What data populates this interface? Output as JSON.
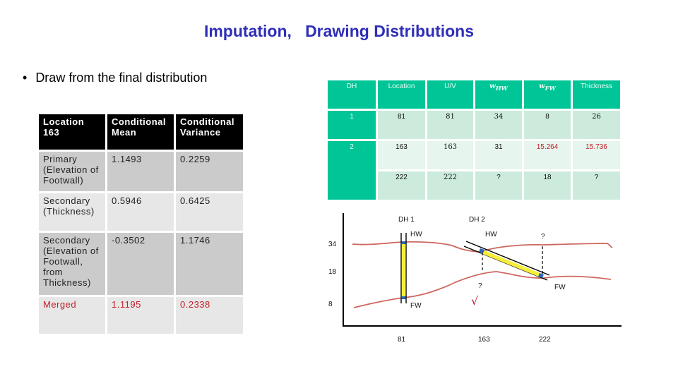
{
  "slide": {
    "title": "Imputation,   Drawing Distributions",
    "bullet": "Draw from the final distribution",
    "bullet_marker": "•"
  },
  "left_table": {
    "headers": [
      "Location 163",
      "Conditional Mean",
      "Conditional Variance"
    ],
    "rows": [
      {
        "label": "Primary (Elevation of Footwall)",
        "mean": "1.1493",
        "variance": "0.2259"
      },
      {
        "label": "Secondary (Thickness)",
        "mean": "0.5946",
        "variance": "0.6425"
      },
      {
        "label": "Secondary (Elevation of Footwall, from Thickness)",
        "mean": "-0.3502",
        "variance": "1.1746"
      },
      {
        "label": "Merged",
        "mean": "1.1195",
        "variance": "0.2338"
      }
    ],
    "highlight_color": "#c0202a"
  },
  "right_table": {
    "headers": [
      "DH",
      "Location",
      "U/V",
      "w",
      "w",
      "Thickness"
    ],
    "header_subscripts": [
      "",
      "",
      "",
      "HW",
      "FW",
      ""
    ],
    "rows": [
      {
        "dh": "1",
        "location": "81",
        "uv": "81",
        "w_hw": "34",
        "w_fw": "8",
        "thickness": "26"
      },
      {
        "dh": "2",
        "location": "163",
        "uv": "163",
        "w_hw": "31",
        "w_fw": "15.264",
        "thickness": "15.736"
      },
      {
        "dh": "",
        "location": "222",
        "uv": "222",
        "w_hw": "?",
        "w_fw": "18",
        "thickness": "?"
      }
    ],
    "accent_color": "#00c596"
  },
  "diagram": {
    "y_labels": [
      "34",
      "18",
      "8"
    ],
    "x_labels": [
      "81",
      "163",
      "222"
    ],
    "drillholes": [
      "DH 1",
      "DH 2"
    ],
    "dh1_top": "HW",
    "dh1_bottom": "FW",
    "dh2_top": "HW",
    "dh2_bottom": "FW",
    "unknown_mark": "?",
    "check_mark": "√"
  }
}
